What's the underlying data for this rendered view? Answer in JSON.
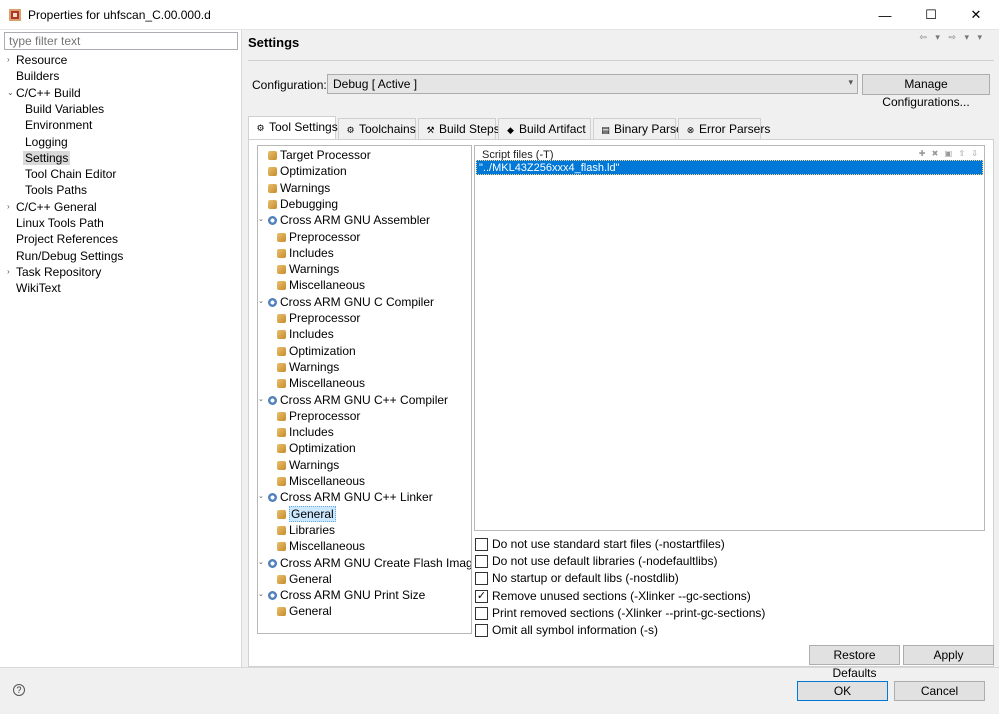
{
  "window": {
    "title": "Properties for uhfscan_C.00.000.d",
    "minimize": "—",
    "maximize": "☐",
    "close": "✕"
  },
  "filter": {
    "placeholder": "type filter text"
  },
  "nav": {
    "items": [
      {
        "label": "Resource",
        "arrow": "›"
      },
      {
        "label": "Builders"
      },
      {
        "label": "C/C++ Build",
        "arrow": "⌄"
      },
      {
        "label": "Build Variables"
      },
      {
        "label": "Environment"
      },
      {
        "label": "Logging"
      },
      {
        "label": "Settings",
        "selected": true
      },
      {
        "label": "Tool Chain Editor"
      },
      {
        "label": "Tools Paths"
      },
      {
        "label": "C/C++ General",
        "arrow": "›"
      },
      {
        "label": "Linux Tools Path"
      },
      {
        "label": "Project References"
      },
      {
        "label": "Run/Debug Settings"
      },
      {
        "label": "Task Repository",
        "arrow": "›"
      },
      {
        "label": "WikiText"
      }
    ]
  },
  "header": {
    "title": "Settings",
    "nav_arrows": "⇦ ▾ ⇨ ▾ ▾"
  },
  "configuration": {
    "label": "Configuration:",
    "value": "Debug  [ Active ]",
    "manage_label": "Manage Configurations..."
  },
  "tabs": [
    {
      "label": "Tool Settings",
      "icon": "⚙",
      "active": true
    },
    {
      "label": "Toolchains",
      "icon": "⚙"
    },
    {
      "label": "Build Steps",
      "icon": "⚒"
    },
    {
      "label": "Build Artifact",
      "icon": "◆"
    },
    {
      "label": "Binary Parsers",
      "icon": "▤"
    },
    {
      "label": "Error Parsers",
      "icon": "⊗"
    }
  ],
  "tree": {
    "nodes": [
      {
        "label": "Target Processor",
        "level": 0,
        "icon": "tool"
      },
      {
        "label": "Optimization",
        "level": 0,
        "icon": "tool"
      },
      {
        "label": "Warnings",
        "level": 0,
        "icon": "tool"
      },
      {
        "label": "Debugging",
        "level": 0,
        "icon": "tool"
      },
      {
        "label": "Cross ARM GNU Assembler",
        "level": 0,
        "icon": "gear",
        "twisty": "⌄"
      },
      {
        "label": "Preprocessor",
        "level": 1,
        "icon": "tool"
      },
      {
        "label": "Includes",
        "level": 1,
        "icon": "tool"
      },
      {
        "label": "Warnings",
        "level": 1,
        "icon": "tool"
      },
      {
        "label": "Miscellaneous",
        "level": 1,
        "icon": "tool"
      },
      {
        "label": "Cross ARM GNU C Compiler",
        "level": 0,
        "icon": "gear",
        "twisty": "⌄"
      },
      {
        "label": "Preprocessor",
        "level": 1,
        "icon": "tool"
      },
      {
        "label": "Includes",
        "level": 1,
        "icon": "tool"
      },
      {
        "label": "Optimization",
        "level": 1,
        "icon": "tool"
      },
      {
        "label": "Warnings",
        "level": 1,
        "icon": "tool"
      },
      {
        "label": "Miscellaneous",
        "level": 1,
        "icon": "tool"
      },
      {
        "label": "Cross ARM GNU C++ Compiler",
        "level": 0,
        "icon": "gear",
        "twisty": "⌄"
      },
      {
        "label": "Preprocessor",
        "level": 1,
        "icon": "tool"
      },
      {
        "label": "Includes",
        "level": 1,
        "icon": "tool"
      },
      {
        "label": "Optimization",
        "level": 1,
        "icon": "tool"
      },
      {
        "label": "Warnings",
        "level": 1,
        "icon": "tool"
      },
      {
        "label": "Miscellaneous",
        "level": 1,
        "icon": "tool"
      },
      {
        "label": "Cross ARM GNU C++ Linker",
        "level": 0,
        "icon": "gear",
        "twisty": "⌄"
      },
      {
        "label": "General",
        "level": 1,
        "icon": "tool",
        "selected": true
      },
      {
        "label": "Libraries",
        "level": 1,
        "icon": "tool"
      },
      {
        "label": "Miscellaneous",
        "level": 1,
        "icon": "tool"
      },
      {
        "label": "Cross ARM GNU Create Flash Image",
        "level": 0,
        "icon": "gear",
        "twisty": "⌄"
      },
      {
        "label": "General",
        "level": 1,
        "icon": "tool"
      },
      {
        "label": "Cross ARM GNU Print Size",
        "level": 0,
        "icon": "gear",
        "twisty": "⌄"
      },
      {
        "label": "General",
        "level": 1,
        "icon": "tool"
      }
    ]
  },
  "script_files": {
    "title": "Script files (-T)",
    "tools": "✚ ✖ ▣ ⇧ ⇩",
    "items": [
      "\"../MKL43Z256xxx4_flash.ld\""
    ]
  },
  "options": [
    {
      "label": "Do not use standard start files (-nostartfiles)",
      "checked": false
    },
    {
      "label": "Do not use default libraries (-nodefaultlibs)",
      "checked": false
    },
    {
      "label": "No startup or default libs (-nostdlib)",
      "checked": false
    },
    {
      "label": "Remove unused sections (-Xlinker --gc-sections)",
      "checked": true
    },
    {
      "label": "Print removed sections (-Xlinker --print-gc-sections)",
      "checked": false
    },
    {
      "label": "Omit all symbol information (-s)",
      "checked": false
    }
  ],
  "buttons": {
    "restore_defaults": "Restore Defaults",
    "apply": "Apply",
    "ok": "OK",
    "cancel": "Cancel",
    "help": "?"
  },
  "colors": {
    "selection": "#0078d7",
    "accent_border": "#0078d7"
  }
}
